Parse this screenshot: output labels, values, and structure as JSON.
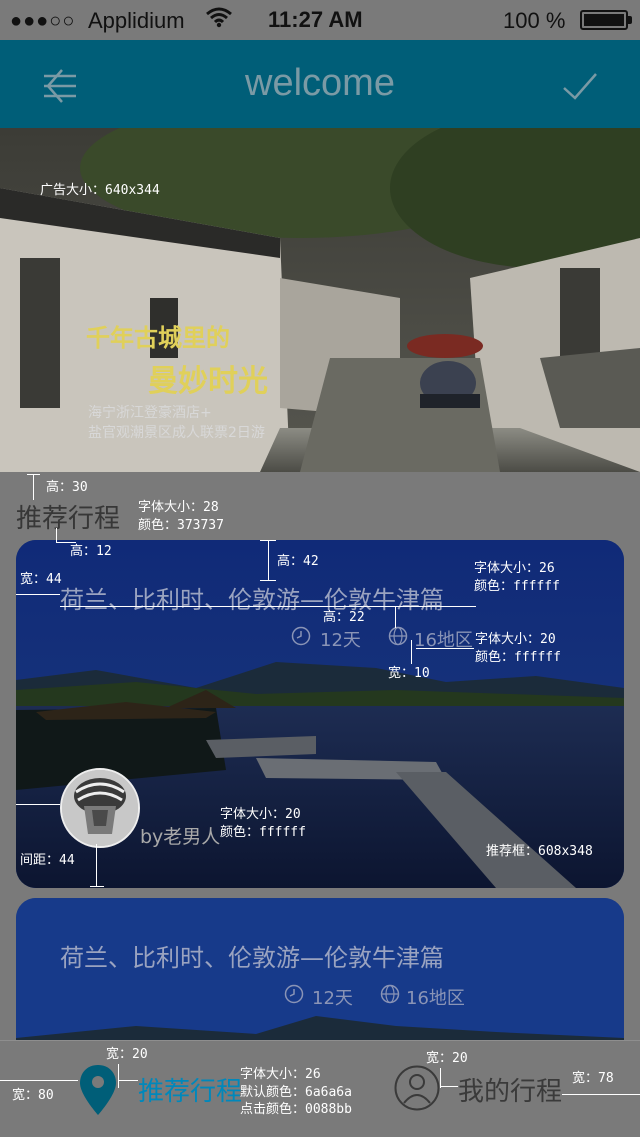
{
  "status_bar": {
    "signal": "●●●○○",
    "carrier": "Applidium",
    "time": "11:27 AM",
    "battery": "100 %"
  },
  "nav": {
    "title": "welcome",
    "left_icon": "menu-icon",
    "right_icon": "check-icon"
  },
  "banner": {
    "annotation": "广告大小：640x344",
    "headline_1": "千年古城里的",
    "headline_2": "曼妙时光",
    "sub_1": "海宁浙江登豪酒店+",
    "sub_2": "盐官观潮景区成人联票2日游"
  },
  "section": {
    "title": "推荐行程",
    "height_annotation": "高：30",
    "font_annotation": "字体大小：28",
    "color_annotation": "颜色：373737"
  },
  "cards": [
    {
      "title": "荷兰、比利时、伦敦游—伦敦牛津篇",
      "days": "12天",
      "regions": "16地区",
      "author": "by老男人"
    },
    {
      "title": "荷兰、比利时、伦敦游—伦敦牛津篇",
      "days": "12天",
      "regions": "16地区"
    }
  ],
  "card_annotations": {
    "a1": "高：12",
    "a2": "高：42",
    "a3": "宽：44",
    "a4_size": "字体大小：26",
    "a4_color": "颜色：ffffff",
    "a5": "高：22",
    "a6_size": "字体大小：20",
    "a6_color": "颜色：ffffff",
    "a7": "宽：10",
    "a8_size": "字体大小：20",
    "a8_color": "颜色：ffffff",
    "a9": "间距：44",
    "a10": "推荐框：608x348"
  },
  "tabbar": {
    "tab1_label": "推荐行程",
    "tab2_label": "我的行程",
    "a_w20_left": "宽：20",
    "a_w80": "宽：80",
    "a_font": "字体大小：26",
    "a_default": "默认颜色：6a6a6a",
    "a_click": "点击颜色：0088bb",
    "a_w20_right": "宽：20",
    "a_w78": "宽：78"
  },
  "colors": {
    "nav_bg": "#005e78",
    "section_title": "#373737",
    "tab_active": "#0088bb",
    "tab_default": "#6a6a6a"
  }
}
